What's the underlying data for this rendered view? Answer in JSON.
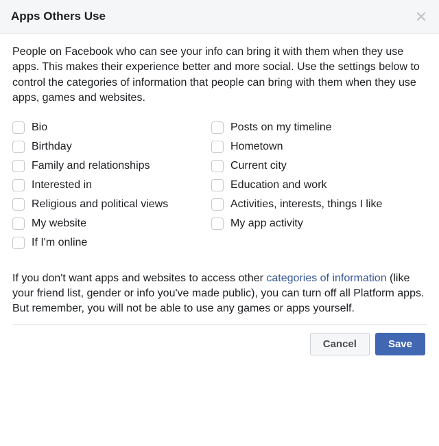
{
  "header": {
    "title": "Apps Others Use"
  },
  "description": "People on Facebook who can see your info can bring it with them when they use apps. This makes their experience better and more social. Use the settings below to control the categories of information that people can bring with them when they use apps, games and websites.",
  "options": {
    "left": [
      "Bio",
      "Birthday",
      "Family and relationships",
      "Interested in",
      "Religious and political views",
      "My website",
      "If I'm online"
    ],
    "right": [
      "Posts on my timeline",
      "Hometown",
      "Current city",
      "Education and work",
      "Activities, interests, things I like",
      "My app activity"
    ]
  },
  "footnote": {
    "pre": "If you don't want apps and websites to access other ",
    "link": "categories of information",
    "post": " (like your friend list, gender or info you've made public), you can turn off all Platform apps. But remember, you will not be able to use any games or apps yourself."
  },
  "actions": {
    "cancel": "Cancel",
    "save": "Save"
  }
}
